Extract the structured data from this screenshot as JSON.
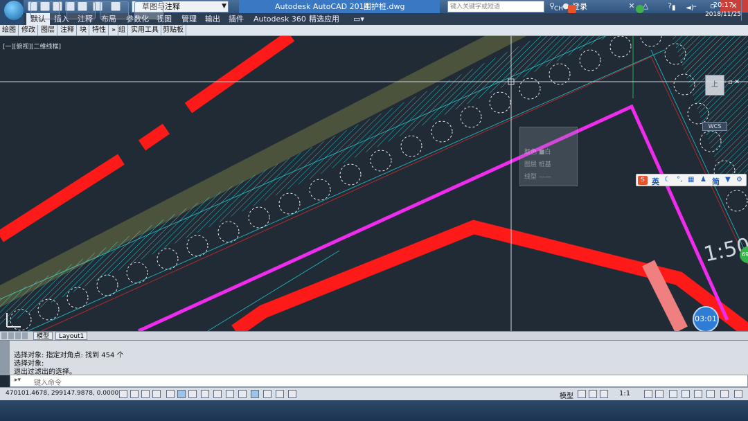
{
  "app": {
    "logo": "A",
    "workspace": "草图与注释",
    "title": "Autodesk AutoCAD 2014",
    "filename": "围护桩.dwg",
    "search_placeholder": "键入关键字或短语",
    "login": "登录",
    "minimize": "–",
    "restore": "▫",
    "close": "✕"
  },
  "ribbon": {
    "tabs": [
      "默认",
      "插入",
      "注释",
      "布局",
      "参数化",
      "视图",
      "管理",
      "输出",
      "插件",
      "Autodesk 360",
      "精选应用"
    ],
    "active_tab": "默认",
    "panels": [
      "绘图",
      "修改",
      "图层",
      "注释",
      "块",
      "特性",
      "组",
      "实用工具",
      "剪贴板"
    ],
    "panel_more": "»"
  },
  "viewport": {
    "label": "[一][俯视][二维线框]",
    "wcs": "WCS",
    "viewcube_face": "上",
    "controls": "– ▫ ✕",
    "slope_text": "1:50",
    "timer": "03:01",
    "badge": "69"
  },
  "tooltip": {
    "lines": [
      "颜色  ■白",
      "图层  桩基",
      "线型  ——"
    ]
  },
  "ime": {
    "logo": "S",
    "mode": "英",
    "script": "简"
  },
  "layout_tabs": [
    "模型",
    "Layout1"
  ],
  "command": {
    "history": [
      "选择对象: 指定对角点: 找到 454 个",
      "选择对象:",
      "退出过滤出的选择。"
    ],
    "prompt_placeholder": "键入命令"
  },
  "status": {
    "coords": "470101.4678, 299147.9878, 0.0000",
    "model": "模型",
    "scale": "1:1"
  },
  "taskbar": {
    "lang": "CH",
    "time": "20:17",
    "date": "2018/11/25"
  },
  "colors": {
    "background": "#212b35",
    "red": "#ff1a1a",
    "magenta": "#ee2cee",
    "cyan": "#2fd6e0",
    "yellow": "#e4e45a",
    "white": "#e8e8e8",
    "accent": "#3a78c4"
  }
}
